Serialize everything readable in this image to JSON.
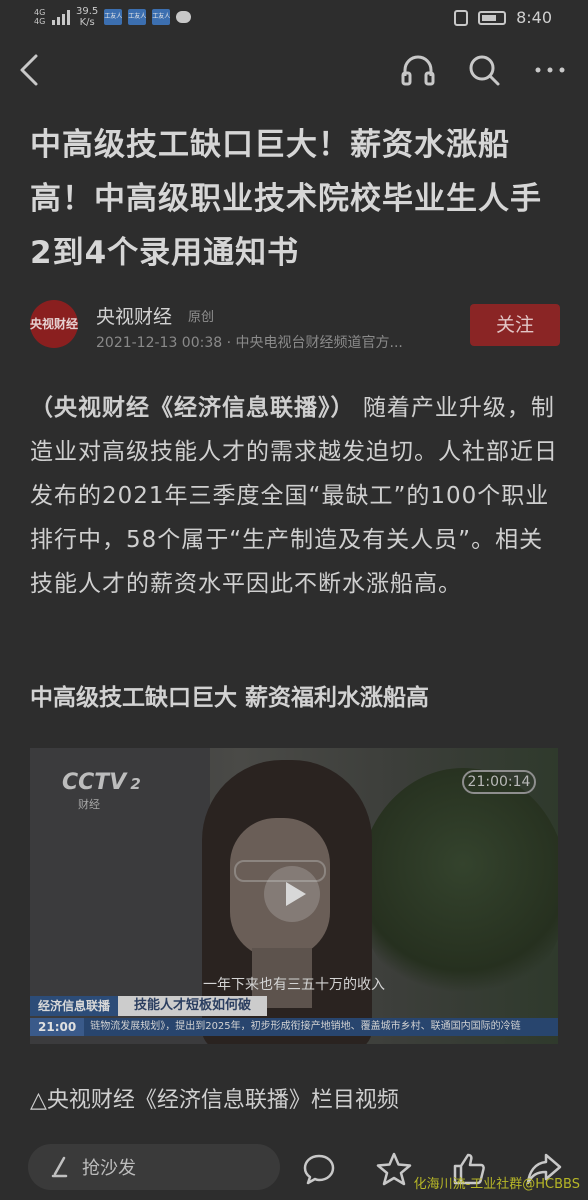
{
  "status_bar": {
    "signal_label": "4G 4G",
    "net_speed_value": "39.5",
    "net_speed_unit": "K/s",
    "app_badges": [
      "工友人",
      "工友人",
      "工友人"
    ],
    "time": "8:40"
  },
  "article": {
    "headline": "中高级技工缺口巨大！薪资水涨船高！中高级职业技术院校毕业生人手2到4个录用通知书",
    "author": {
      "avatar_text": "央视财经",
      "name": "央视财经",
      "tag": "原创",
      "meta": "2021-12-13 00:38 · 中央电视台财经频道官方..."
    },
    "follow_label": "关注",
    "body_lead": "（央视财经《经济信息联播》）",
    "body_rest": "随着产业升级，制造业对高级技能人才的需求越发迫切。人社部近日发布的2021年三季度全国“最缺工”的100个职业排行中，58个属于“生产制造及有关人员”。相关技能人才的薪资水平因此不断水涨船高。",
    "subheading": "中高级技工缺口巨大 薪资福利水涨船高",
    "video": {
      "channel_logo": "CCTV",
      "channel_num": "2",
      "channel_sub": "财经",
      "timecode": "21:00:14",
      "subtitle": "一年下来也有三五十万的收入",
      "program": "经济信息联播",
      "segment_title": "技能人才短板如何破",
      "ticker_time": "21:00",
      "ticker_text": "链物流发展规划》，提出到2025年，初步形成衔接产地销地、覆盖城市乡村、联通国内国际的冷链"
    },
    "caption": "△央视财经《经济信息联播》栏目视频"
  },
  "bottom_bar": {
    "comment_placeholder": "抢沙发"
  },
  "watermark": "化海川流-工业社群@HCBBS",
  "icons": [
    "back-icon",
    "headphones-icon",
    "search-icon",
    "more-icon",
    "pen-icon",
    "comment-icon",
    "star-icon",
    "like-icon",
    "share-icon"
  ],
  "colors": {
    "background": "#2d2d2d",
    "follow_button": "#8a2525",
    "avatar": "#8a1f1f",
    "watermark": "#b6b627"
  }
}
